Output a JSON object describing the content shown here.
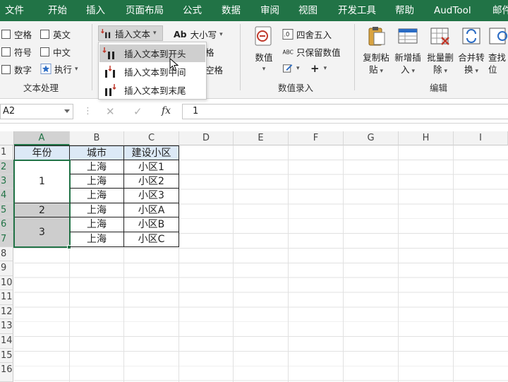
{
  "menu": [
    "文件",
    "开始",
    "插入",
    "页面布局",
    "公式",
    "数据",
    "审阅",
    "视图",
    "开发工具",
    "帮助",
    "AudTool",
    "邮件"
  ],
  "ribbon": {
    "text_group": {
      "label": "文本处理",
      "checkboxes": [
        "空格",
        "英文",
        "符号",
        "中文",
        "数字"
      ],
      "exec_label": "执行"
    },
    "insert_text_label": "插入文本",
    "case_label": "大小写",
    "partial_labels": [
      "格",
      "空格"
    ],
    "value_group": {
      "label": "数值录入",
      "value_label": "数值",
      "round_label": "四舍五入",
      "keep_number_label": "只保留数值"
    },
    "edit_group": {
      "label": "编辑",
      "buttons": [
        {
          "line1": "复制粘",
          "line2": "贴"
        },
        {
          "line1": "新增插",
          "line2": "入"
        },
        {
          "line1": "批量删",
          "line2": "除"
        },
        {
          "line1": "合并转",
          "line2": "换"
        },
        {
          "line1": "查找",
          "line2": "位"
        }
      ]
    }
  },
  "dropdown": {
    "items": [
      "插入文本到开头",
      "插入文本到中间",
      "插入文本到末尾"
    ]
  },
  "formula_bar": {
    "cell_ref": "A2",
    "fx": "fx",
    "value": "1"
  },
  "sheet": {
    "columns": [
      "A",
      "B",
      "C",
      "D",
      "E",
      "F",
      "G",
      "H",
      "I"
    ],
    "rows": [
      "1",
      "2",
      "3",
      "4",
      "5",
      "6",
      "7",
      "8",
      "9",
      "10",
      "11",
      "12",
      "13",
      "14",
      "15",
      "16"
    ],
    "header": [
      "年份",
      "城市",
      "建设小区"
    ],
    "merged_years": [
      "1",
      "2",
      "3"
    ],
    "cities": [
      "上海",
      "上海",
      "上海",
      "上海",
      "上海",
      "上海"
    ],
    "districts": [
      "小区1",
      "小区2",
      "小区3",
      "小区A",
      "小区B",
      "小区C"
    ]
  },
  "colors": {
    "brand": "#217346",
    "header_fill": "#dce9f6",
    "selection_fill": "#cdcdcd"
  }
}
